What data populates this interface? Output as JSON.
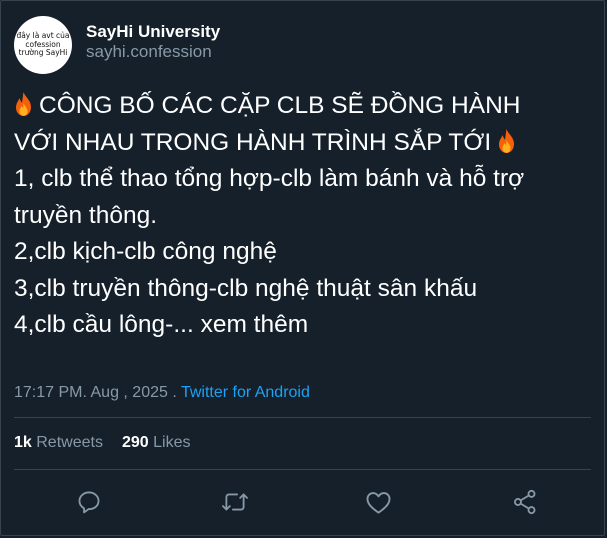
{
  "account": {
    "display_name": "SayHi University",
    "handle": "sayhi.confession",
    "avatar_lines": [
      "đây là avt của",
      "cofession",
      "trường SayHi"
    ]
  },
  "tweet": {
    "line1": "CÔNG BỐ CÁC CẶP CLB SẼ ĐỒNG HÀNH",
    "line2": "VỚI NHAU TRONG HÀNH TRÌNH SẮP TỚI",
    "line3": "1, clb thể thao tổng hợp-clb làm bánh và hỗ trợ",
    "line4": "truyền thông.",
    "line5": "2,clb kịch-clb công nghệ",
    "line6": "3,clb truyền thông-clb nghệ thuật sân khấu",
    "line7": "4,clb cầu lông-... xem thêm",
    "leading_icon": "fire-emoji",
    "trailing_icon": "fire-emoji"
  },
  "meta": {
    "timestamp": "17:17 PM. Aug , 2025 .",
    "source": "Twitter for Android"
  },
  "stats": {
    "retweets_count": "1k",
    "retweets_label": "Retweets",
    "likes_count": "290",
    "likes_label": "Likes"
  },
  "actions": {
    "icons": [
      "reply-icon",
      "retweet-icon",
      "like-icon",
      "share-icon"
    ],
    "icon_color": "#8899a6"
  },
  "colors": {
    "background": "#15202b",
    "text": "#ffffff",
    "secondary": "#8899a6",
    "link": "#1da1f2",
    "border": "#38444d"
  }
}
